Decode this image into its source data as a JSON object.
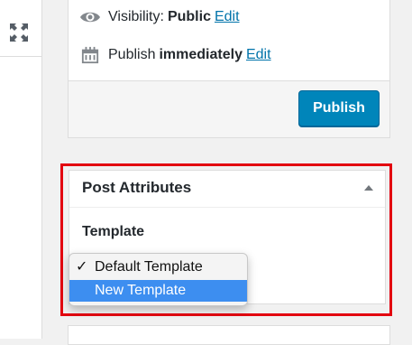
{
  "left_panel": {
    "icon": "expand-icon"
  },
  "publish": {
    "visibility_label": "Visibility:",
    "visibility_value": "Public",
    "visibility_edit": "Edit",
    "publish_label": "Publish",
    "publish_value": "immediately",
    "publish_edit": "Edit",
    "publish_button": "Publish",
    "icons": [
      "eye-icon",
      "calendar-icon"
    ]
  },
  "post_attributes": {
    "title": "Post Attributes",
    "template_label": "Template",
    "toggle_icon": "caret-up-icon",
    "dropdown": {
      "options": [
        {
          "check": "✓",
          "label": "Default Template",
          "selected": true
        },
        {
          "check": "",
          "label": "New Template",
          "highlighted": true
        }
      ]
    }
  },
  "colors": {
    "accent": "#0085ba",
    "link": "#0073aa",
    "highlight_frame": "#e3000f",
    "dropdown_highlight": "#3d8ef0"
  }
}
